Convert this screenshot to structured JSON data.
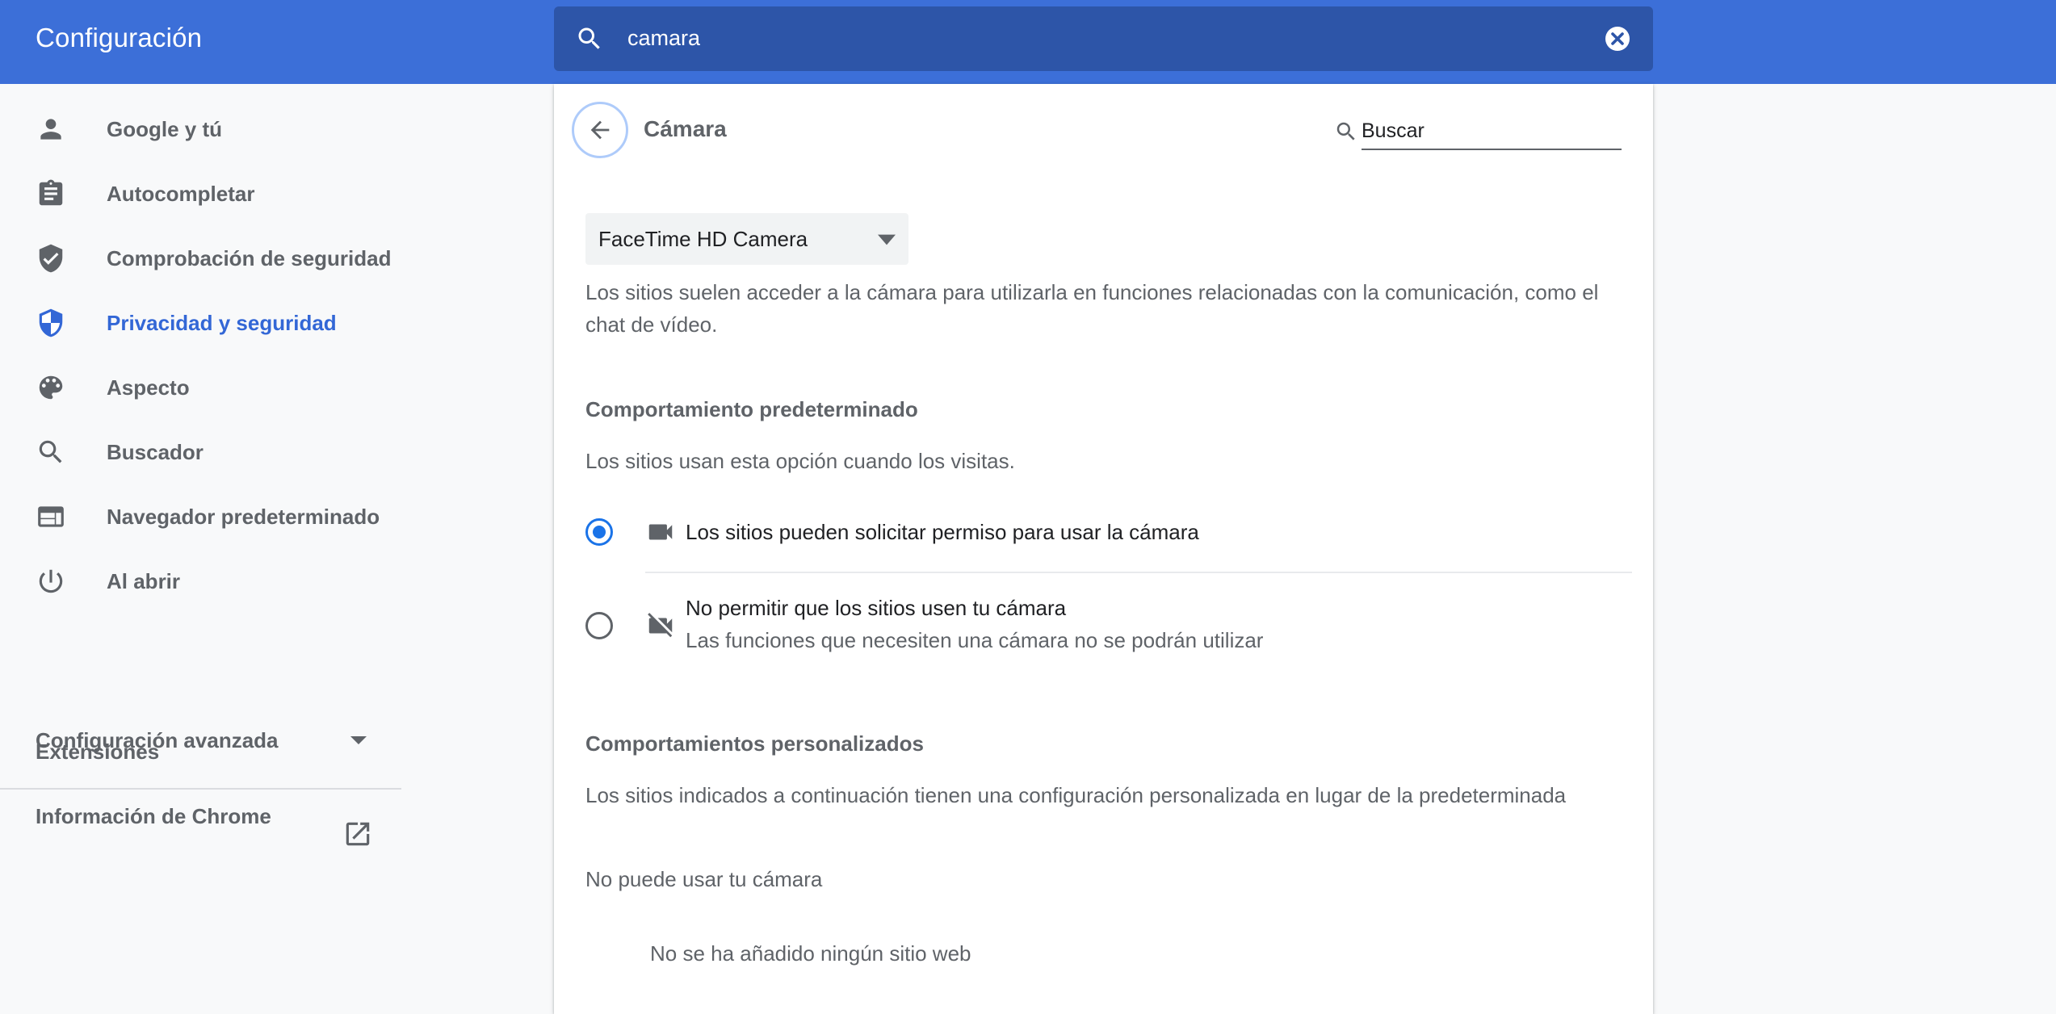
{
  "header": {
    "title": "Configuración",
    "search_value": "camara"
  },
  "sidebar": {
    "items": [
      {
        "label": "Google y tú",
        "icon": "person-icon"
      },
      {
        "label": "Autocompletar",
        "icon": "clipboard-icon"
      },
      {
        "label": "Comprobación de seguridad",
        "icon": "shield-check-icon"
      },
      {
        "label": "Privacidad y seguridad",
        "icon": "shield-privacy-icon",
        "active": true
      },
      {
        "label": "Aspecto",
        "icon": "palette-icon"
      },
      {
        "label": "Buscador",
        "icon": "search-icon"
      },
      {
        "label": "Navegador predeterminado",
        "icon": "browser-icon"
      },
      {
        "label": "Al abrir",
        "icon": "power-icon"
      }
    ],
    "advanced_label": "Configuración avanzada",
    "extensions_label": "Extensiones",
    "about_label": "Información de Chrome"
  },
  "content": {
    "page_title": "Cámara",
    "search_placeholder": "Buscar",
    "camera_select": "FaceTime HD Camera",
    "description": "Los sitios suelen acceder a la cámara para utilizarla en funciones relacionadas con la comunicación, como el chat de vídeo.",
    "default_behavior": {
      "heading": "Comportamiento predeterminado",
      "subtitle": "Los sitios usan esta opción cuando los visitas.",
      "options": [
        {
          "label": "Los sitios pueden solicitar permiso para usar la cámara",
          "sub": "",
          "selected": true,
          "icon": "videocam-icon"
        },
        {
          "label": "No permitir que los sitios usen tu cámara",
          "sub": "Las funciones que necesiten una cámara no se podrán utilizar",
          "selected": false,
          "icon": "videocam-off-icon"
        }
      ]
    },
    "custom_behavior": {
      "heading": "Comportamientos personalizados",
      "subtitle": "Los sitios indicados a continuación tienen una configuración personalizada en lugar de la predeterminada",
      "blocked_heading": "No puede usar tu cámara",
      "empty_text": "No se ha añadido ningún sitio web"
    }
  },
  "colors": {
    "header_bg": "#3c6fd8",
    "search_bg": "#2d55a8",
    "accent": "#1a73e8",
    "active_nav": "#3367d6"
  }
}
